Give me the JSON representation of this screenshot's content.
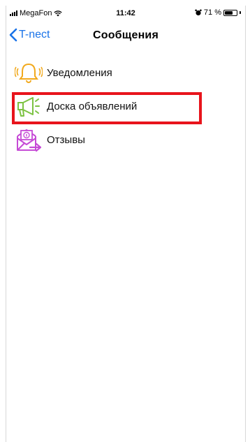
{
  "status_bar": {
    "carrier": "MegaFon",
    "time": "11:42",
    "battery_percent": "71 %",
    "battery_level": 0.71
  },
  "nav": {
    "back_label": "T-nect",
    "title": "Сообщения"
  },
  "menu": {
    "items": [
      {
        "label": "Уведомления",
        "icon": "bell-icon",
        "color": "#f2a91c"
      },
      {
        "label": "Доска объявлений",
        "icon": "megaphone-icon",
        "color": "#7cc242"
      },
      {
        "label": "Отзывы",
        "icon": "mail-icon",
        "color": "#c64bd6"
      }
    ]
  },
  "colors": {
    "accent": "#1a73e8",
    "highlight": "#e8141c"
  }
}
